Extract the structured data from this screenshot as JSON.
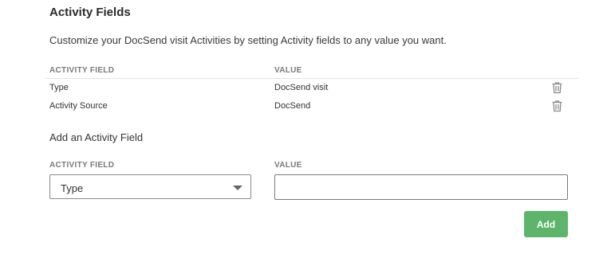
{
  "section": {
    "title": "Activity Fields",
    "description": "Customize your DocSend visit Activities by setting Activity fields to any value you want."
  },
  "table": {
    "columns": [
      "ACTIVITY FIELD",
      "VALUE"
    ],
    "rows": [
      {
        "field": "Type",
        "value": "DocSend visit"
      },
      {
        "field": "Activity Source",
        "value": "DocSend"
      }
    ],
    "row_action_icon": "trash-icon"
  },
  "add_form": {
    "title": "Add an Activity Field",
    "field_label": "ACTIVITY FIELD",
    "value_label": "VALUE",
    "field_selected": "Type",
    "value_input": "",
    "value_placeholder": "",
    "add_label": "Add",
    "add_color": "#5cb56b"
  }
}
